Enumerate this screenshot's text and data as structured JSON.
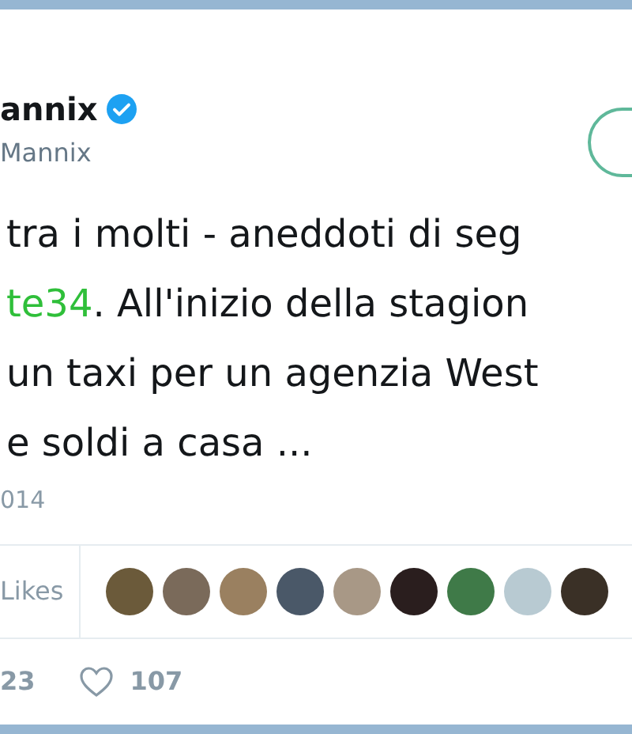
{
  "author": {
    "name": "annix",
    "verified": true,
    "handle": "Mannix"
  },
  "tweet_lines": [
    [
      {
        "kind": "text",
        "text": "tra i molti - aneddoti di seg"
      }
    ],
    [
      {
        "kind": "hashtag",
        "text": "te34"
      },
      {
        "kind": "text",
        "text": ". All'inizio della stagion"
      }
    ],
    [
      {
        "kind": "text",
        "text": "un taxi per un agenzia West"
      }
    ],
    [
      {
        "kind": "text",
        "text": "e soldi a casa ..."
      }
    ]
  ],
  "date": "014",
  "likes_label": "Likes",
  "actions": [
    {
      "kind": "count",
      "text": "23"
    },
    {
      "kind": "like",
      "text": "107"
    }
  ]
}
